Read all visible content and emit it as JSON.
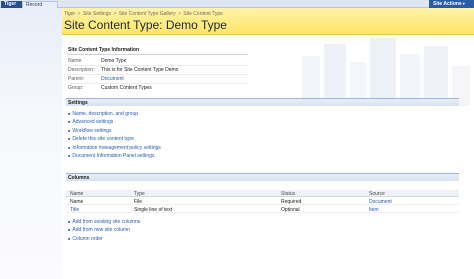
{
  "topbar": {
    "site_tab": "Tiger",
    "record_center_tab": "Record Center",
    "site_actions": "Site Actions",
    "site_actions_arrow": "▾"
  },
  "breadcrumb": {
    "items": [
      "Tiger",
      "Site Settings",
      "Site Content Type Gallery",
      "Site Content Type"
    ],
    "separator": ">"
  },
  "page_title": "Site Content Type: Demo Type",
  "info": {
    "header": "Site Content Type Information",
    "rows": [
      {
        "label": "Name:",
        "value": "Demo Type"
      },
      {
        "label": "Description:",
        "value": "This is for Site Content Type Demo"
      },
      {
        "label": "Parent:",
        "value": "Document"
      },
      {
        "label": "Group:",
        "value": "Custom Content Types"
      }
    ]
  },
  "settings": {
    "header": "Settings",
    "links": [
      "Name, description, and group",
      "Advanced settings",
      "Workflow settings",
      "Delete this site content type",
      "Information management policy settings",
      "Document Information Panel settings"
    ]
  },
  "columns": {
    "header": "Columns",
    "table_headers": [
      "Name",
      "Type",
      "Status",
      "Source"
    ],
    "rows": [
      [
        "Name",
        "File",
        "Required",
        "Document"
      ],
      [
        "Title",
        "Single line of text",
        "Optional",
        "Item"
      ]
    ],
    "links": [
      "Add from existing site columns",
      "Add from new site column",
      "Column order"
    ]
  },
  "colors": {
    "accent": "#2a5ca8",
    "title_band": "#ffe567",
    "link": "#2b5aa8"
  },
  "icons": {
    "bullet": "bullet-icon",
    "dropdown": "chevron-down-icon"
  }
}
